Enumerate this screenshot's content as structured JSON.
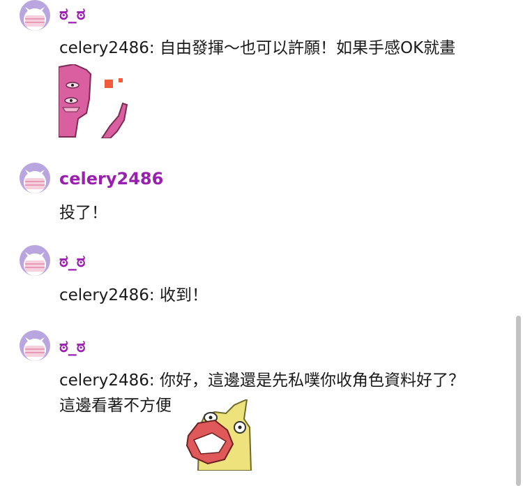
{
  "messages": [
    {
      "author": "ಠ_ಠ",
      "lines": [
        "celery2486: 自由發揮～也可以許願！如果手感OK就畫"
      ],
      "avatar_icon": "masked-face-avatar-icon",
      "sticker_icon": "pink-blob-sticker"
    },
    {
      "author": "celery2486",
      "lines": [
        "投了！"
      ],
      "avatar_icon": "masked-face-avatar-icon"
    },
    {
      "author": "ಠ_ಠ",
      "lines": [
        "celery2486: 收到！"
      ],
      "avatar_icon": "masked-face-avatar-icon"
    },
    {
      "author": "ಠ_ಠ",
      "lines": [
        "celery2486: 你好，這邊還是先私噗你收角色資料好了？",
        "這邊看著不方便"
      ],
      "avatar_icon": "masked-face-avatar-icon",
      "sticker_icon": "yellow-laughing-sticker"
    }
  ],
  "colors": {
    "author_name": "#9a1fb0",
    "avatar_bg": "#b9a6e0",
    "text": "#1a1a1a",
    "scrollbar_thumb": "#c2c2c2"
  }
}
